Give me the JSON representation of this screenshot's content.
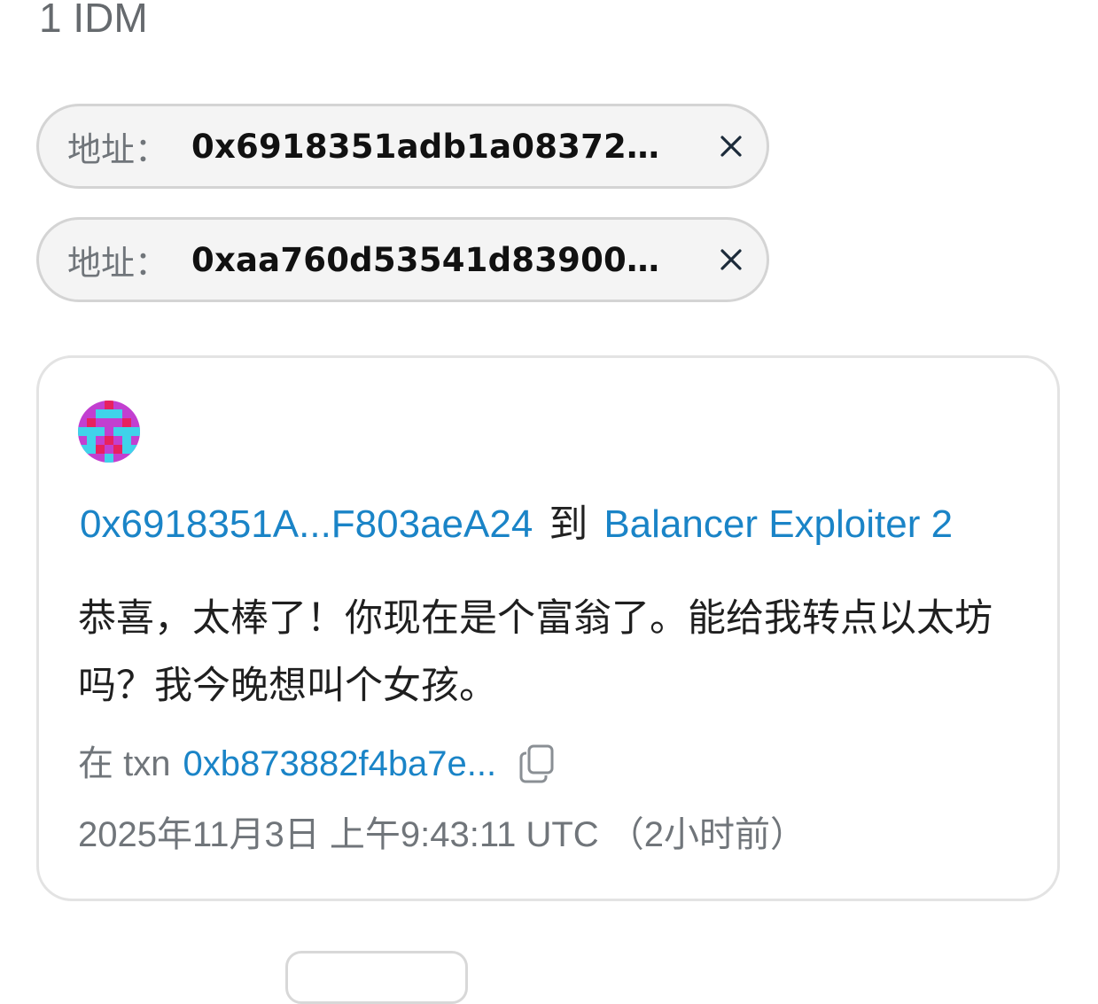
{
  "result_count": "1 IDM",
  "filters": [
    {
      "key_label": "地址：",
      "value": "0x6918351adb1a08372d4..."
    },
    {
      "key_label": "地址：",
      "value": "0xaa760d53541d8390074..."
    }
  ],
  "message_card": {
    "from": "0x6918351A...F803aeA24",
    "to_word": "到",
    "to": "Balancer Exploiter 2",
    "text": "恭喜，太棒了！你现在是个富翁了。能给我转点以太坊吗？我今晚想叫个女孩。",
    "txn_prefix": "在 txn",
    "txn_hash": "0xb873882f4ba7e...",
    "timestamp": "2025年11月3日 上午9:43:11 UTC （2小时前）"
  },
  "colors": {
    "link": "#1a84c7",
    "muted": "#70757a",
    "chip_background": "#f4f4f4"
  },
  "icons": {
    "remove_filter": "close-icon",
    "copy": "copy-icon"
  }
}
